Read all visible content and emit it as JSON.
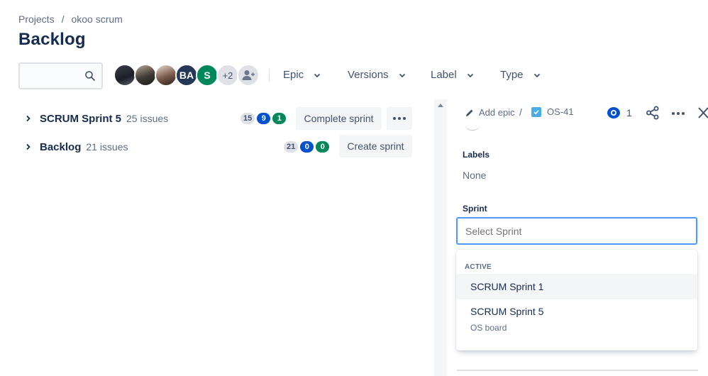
{
  "breadcrumb": {
    "projects": "Projects",
    "separator": "/",
    "project": "okoo scrum"
  },
  "page_title": "Backlog",
  "search": {
    "value": "",
    "placeholder": ""
  },
  "avatars": {
    "ba": "BA",
    "s": "S",
    "more": "+2"
  },
  "filters": {
    "epic": "Epic",
    "versions": "Versions",
    "label": "Label",
    "type": "Type"
  },
  "sprints": [
    {
      "name": "SCRUM Sprint 5",
      "count": "25 issues",
      "todo": "15",
      "in_progress": "9",
      "done": "1",
      "action": "Complete sprint"
    },
    {
      "name": "Backlog",
      "count": "21 issues",
      "todo": "21",
      "in_progress": "0",
      "done": "0",
      "action": "Create sprint"
    }
  ],
  "panel": {
    "add_epic": "Add epic",
    "separator": "/",
    "issue_key": "OS-41",
    "watchers": "1",
    "labels_label": "Labels",
    "labels_value": "None",
    "sprint_label": "Sprint",
    "sprint_placeholder": "Select Sprint",
    "dropdown": {
      "group": "ACTIVE",
      "options": [
        {
          "label": "SCRUM Sprint 1",
          "sub": ""
        },
        {
          "label": "SCRUM Sprint 5",
          "sub": "OS board"
        }
      ]
    }
  },
  "colors": {
    "blue": "#0052cc",
    "green": "#00875a",
    "focus": "#4c9aff",
    "text": "#172b4d"
  }
}
